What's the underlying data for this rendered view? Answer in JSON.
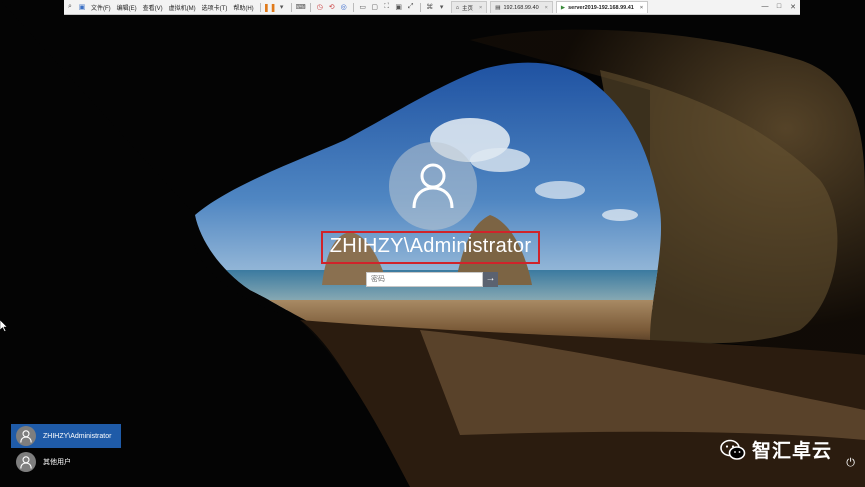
{
  "toolbar": {
    "menus": [
      "文件(F)",
      "编辑(E)",
      "查看(V)",
      "虚拟机(M)",
      "选项卡(T)",
      "帮助(H)"
    ],
    "tabs": [
      {
        "label": "主页",
        "active": false
      },
      {
        "label": "192.168.99.40",
        "active": false
      },
      {
        "label": "server2019-192.168.99.41",
        "active": true
      }
    ],
    "window_controls": [
      "—",
      "□",
      "✕"
    ]
  },
  "login": {
    "username": "ZHIHZY\\Administrator",
    "password_placeholder": "密码",
    "submit_glyph": "→"
  },
  "user_list": [
    {
      "name": "ZHIHZY\\Administrator",
      "selected": true
    },
    {
      "name": "其他用户",
      "selected": false
    }
  ],
  "watermark": {
    "text": "智汇卓云"
  },
  "colors": {
    "selected_user": "#1f5ba8",
    "highlight_border": "#d0232a"
  }
}
